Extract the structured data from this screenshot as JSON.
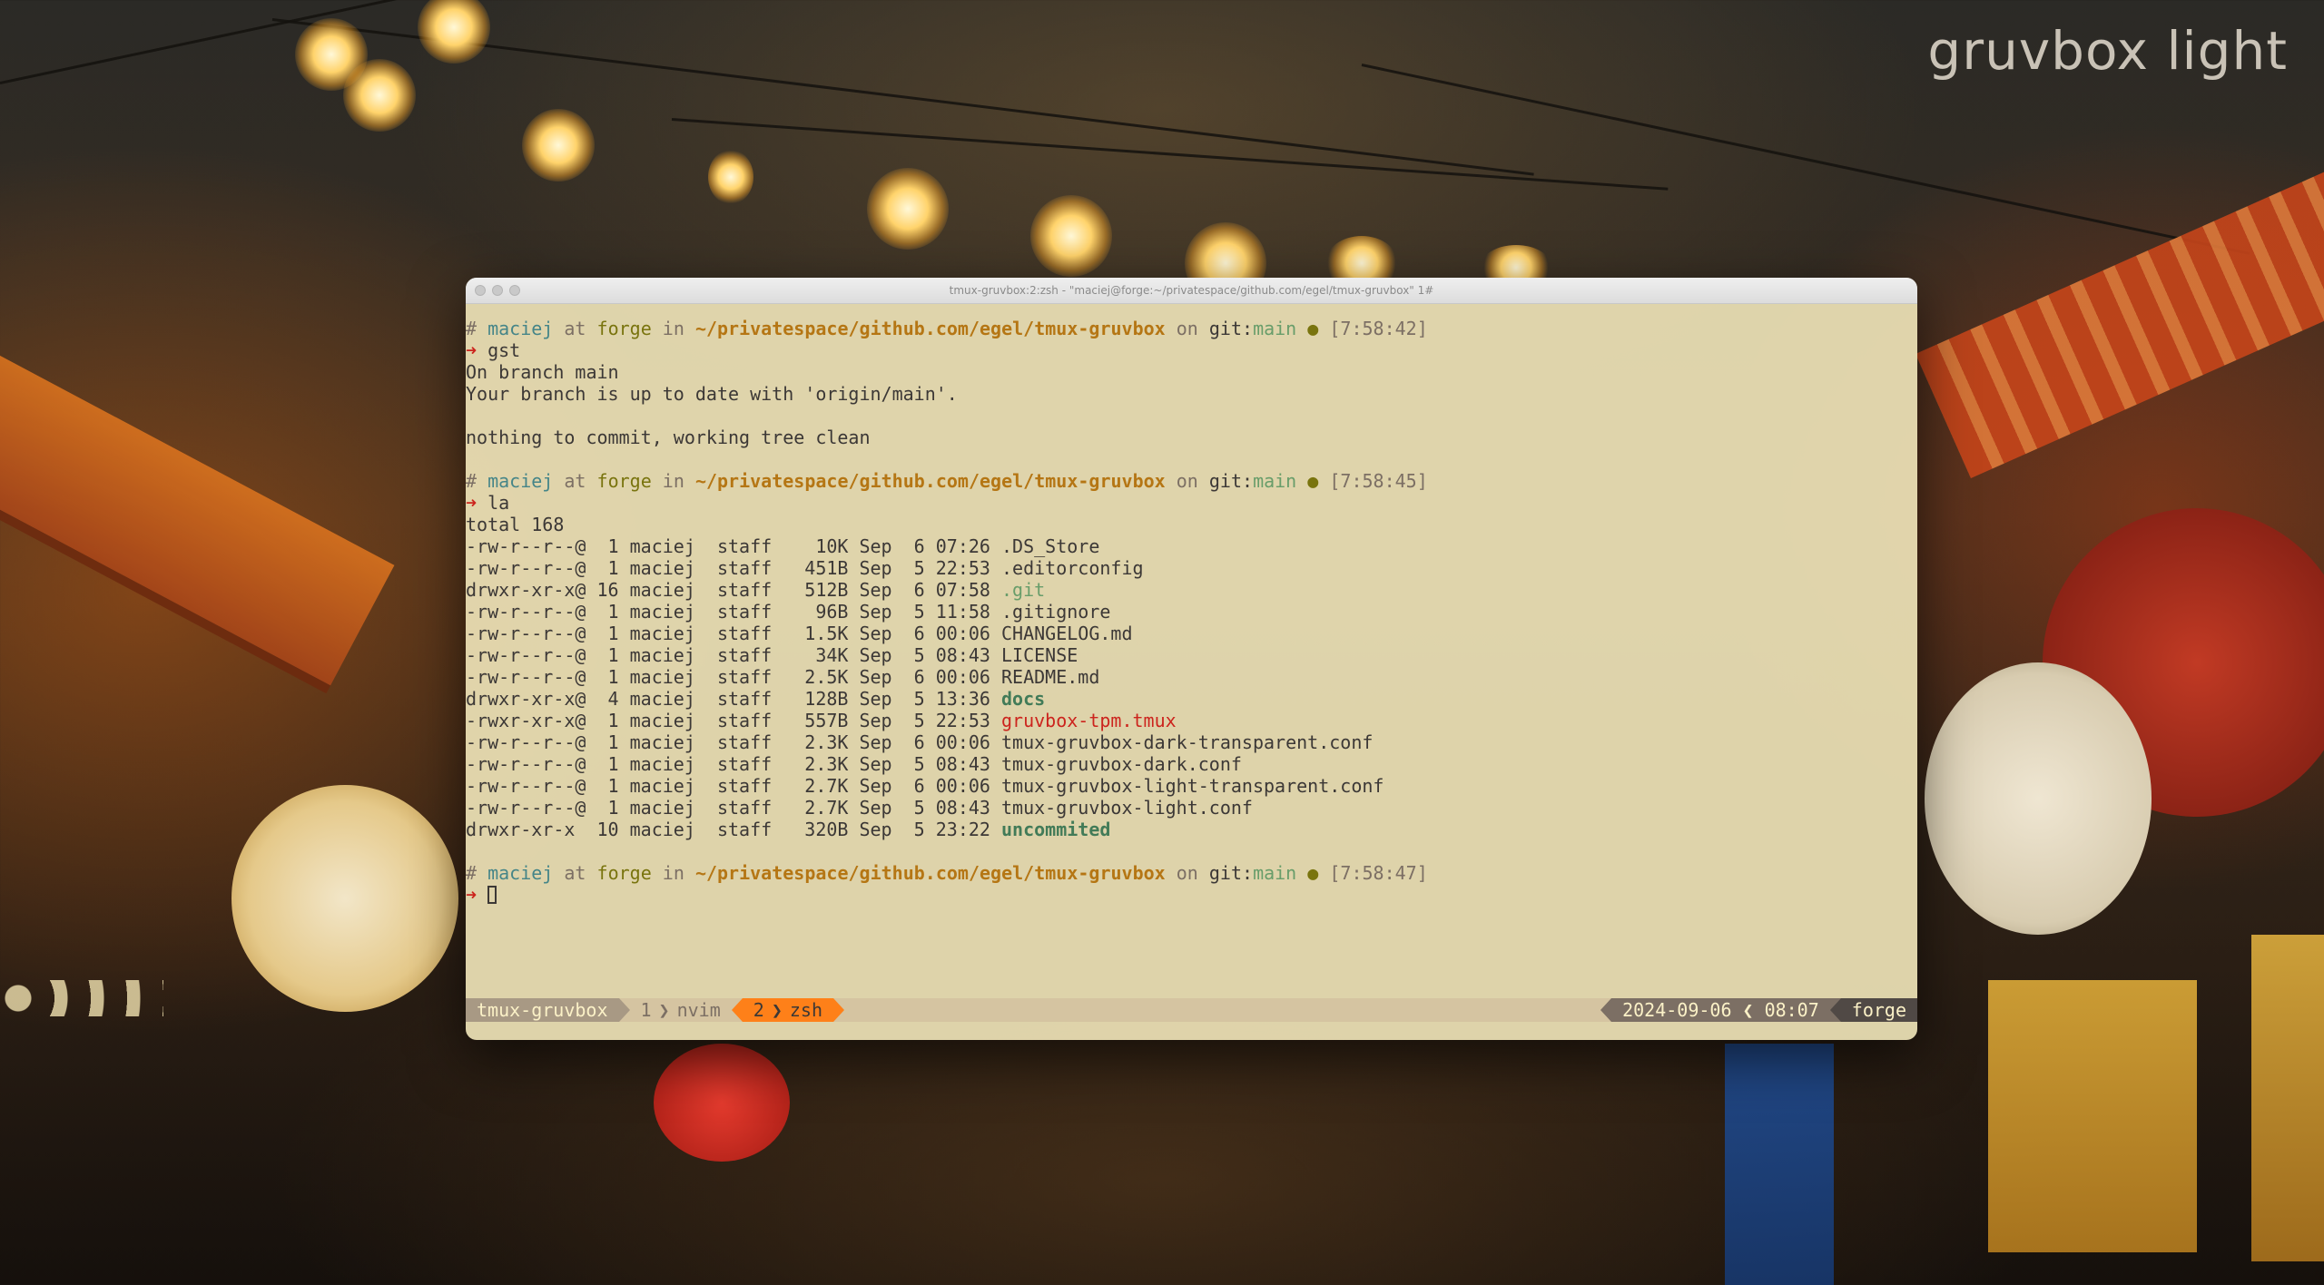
{
  "theme_label": "gruvbox light",
  "window": {
    "title": "tmux-gruvbox:2:zsh - \"maciej@forge:~/privatespace/github.com/egel/tmux-gruvbox\" 1#"
  },
  "prompt": {
    "hash": "#",
    "user": "maciej",
    "at": "at",
    "host": "forge",
    "in": "in",
    "path": "~/privatespace/github.com/egel/tmux-gruvbox",
    "on": "on",
    "git_label": "git:",
    "branch": "main",
    "dot": "●",
    "arrow": "➜"
  },
  "blocks": [
    {
      "time": "[7:58:42]",
      "command": "gst",
      "output": [
        "On branch main",
        "Your branch is up to date with 'origin/main'.",
        "",
        "nothing to commit, working tree clean",
        ""
      ]
    },
    {
      "time": "[7:58:45]",
      "command": "la",
      "total": "total 168",
      "listing": [
        {
          "prefix": "-rw-r--r--@  1 maciej  staff    10K Sep  6 07:26 ",
          "name": ".DS_Store",
          "kind": "file"
        },
        {
          "prefix": "-rw-r--r--@  1 maciej  staff   451B Sep  5 22:53 ",
          "name": ".editorconfig",
          "kind": "file"
        },
        {
          "prefix": "drwxr-xr-x@ 16 maciej  staff   512B Sep  6 07:58 ",
          "name": ".git",
          "kind": "dir"
        },
        {
          "prefix": "-rw-r--r--@  1 maciej  staff    96B Sep  5 11:58 ",
          "name": ".gitignore",
          "kind": "file"
        },
        {
          "prefix": "-rw-r--r--@  1 maciej  staff   1.5K Sep  6 00:06 ",
          "name": "CHANGELOG.md",
          "kind": "file"
        },
        {
          "prefix": "-rw-r--r--@  1 maciej  staff    34K Sep  5 08:43 ",
          "name": "LICENSE",
          "kind": "file"
        },
        {
          "prefix": "-rw-r--r--@  1 maciej  staff   2.5K Sep  6 00:06 ",
          "name": "README.md",
          "kind": "file"
        },
        {
          "prefix": "drwxr-xr-x@  4 maciej  staff   128B Sep  5 13:36 ",
          "name": "docs",
          "kind": "dir-bold"
        },
        {
          "prefix": "-rwxr-xr-x@  1 maciej  staff   557B Sep  5 22:53 ",
          "name": "gruvbox-tpm.tmux",
          "kind": "exec"
        },
        {
          "prefix": "-rw-r--r--@  1 maciej  staff   2.3K Sep  6 00:06 ",
          "name": "tmux-gruvbox-dark-transparent.conf",
          "kind": "file"
        },
        {
          "prefix": "-rw-r--r--@  1 maciej  staff   2.3K Sep  5 08:43 ",
          "name": "tmux-gruvbox-dark.conf",
          "kind": "file"
        },
        {
          "prefix": "-rw-r--r--@  1 maciej  staff   2.7K Sep  6 00:06 ",
          "name": "tmux-gruvbox-light-transparent.conf",
          "kind": "file"
        },
        {
          "prefix": "-rw-r--r--@  1 maciej  staff   2.7K Sep  5 08:43 ",
          "name": "tmux-gruvbox-light.conf",
          "kind": "file"
        },
        {
          "prefix": "drwxr-xr-x  10 maciej  staff   320B Sep  5 23:22 ",
          "name": "uncommited",
          "kind": "dir-bold"
        }
      ]
    },
    {
      "time": "[7:58:47]",
      "command": ""
    }
  ],
  "statusbar": {
    "session": "tmux-gruvbox",
    "windows": [
      {
        "index": "1",
        "name": "nvim",
        "active": false
      },
      {
        "index": "2",
        "name": "zsh",
        "active": true
      }
    ],
    "date": "2024-09-06",
    "time": "08:07",
    "host": "forge",
    "sep": "❯",
    "sep_left": "❮"
  },
  "colors": {
    "terminal_bg": "#ece1b6",
    "fg": "#3c3836",
    "user": "#458588",
    "host": "#79740e",
    "path": "#b57614",
    "branch": "#79740e",
    "arrow": "#cc241d",
    "dir": "#427b58",
    "exec": "#cc241d",
    "active_window": "#fe8019"
  }
}
